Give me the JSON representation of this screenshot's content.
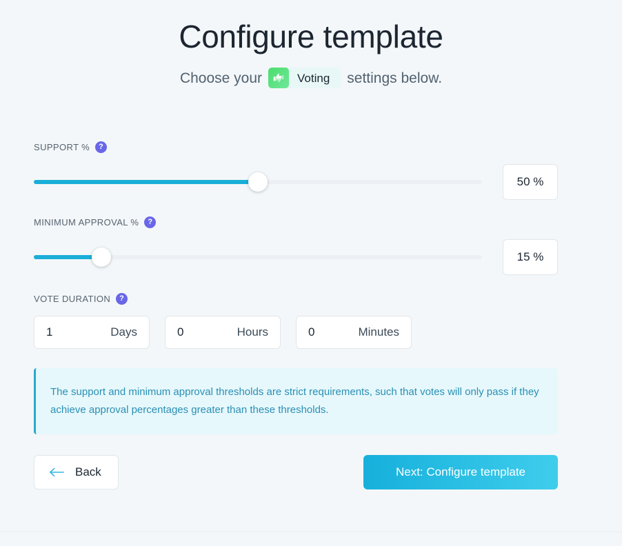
{
  "header": {
    "title": "Configure template",
    "subtitle_prefix": "Choose your",
    "subtitle_suffix": "settings below.",
    "app_badge": {
      "label": "Voting",
      "icon": "voting-thumbs-icon",
      "icon_bg_color": "#4ade6d",
      "badge_bg_color": "#e8f8f7"
    }
  },
  "fields": {
    "support": {
      "label": "SUPPORT %",
      "help_icon": "question-mark-icon",
      "value": 50,
      "value_display": "50 %",
      "min": 0,
      "max": 100,
      "fill_color": "#1aaed8",
      "track_color": "#eceff3"
    },
    "minimum_approval": {
      "label": "MINIMUM APPROVAL %",
      "help_icon": "question-mark-icon",
      "value": 15,
      "value_display": "15 %",
      "min": 0,
      "max": 100,
      "fill_color": "#1aaed8",
      "track_color": "#eceff3"
    },
    "vote_duration": {
      "label": "VOTE DURATION",
      "help_icon": "question-mark-icon",
      "inputs": [
        {
          "value": "1",
          "unit": "Days"
        },
        {
          "value": "0",
          "unit": "Hours"
        },
        {
          "value": "0",
          "unit": "Minutes"
        }
      ]
    }
  },
  "info_box": {
    "text": "The support and minimum approval thresholds are strict requirements, such that votes will only pass if they achieve approval percentages greater than these thresholds.",
    "accent_color": "#2aa9cf",
    "background_color": "#e6f8fb"
  },
  "buttons": {
    "back": {
      "label": "Back",
      "icon": "arrow-left-icon",
      "icon_color": "#30b6e0"
    },
    "next": {
      "label": "Next: Configure template",
      "gradient_from": "#16b0dc",
      "gradient_to": "#3fcdec"
    }
  },
  "theme": {
    "page_background": "#f3f7f9",
    "help_icon_color": "#6a66e8"
  }
}
